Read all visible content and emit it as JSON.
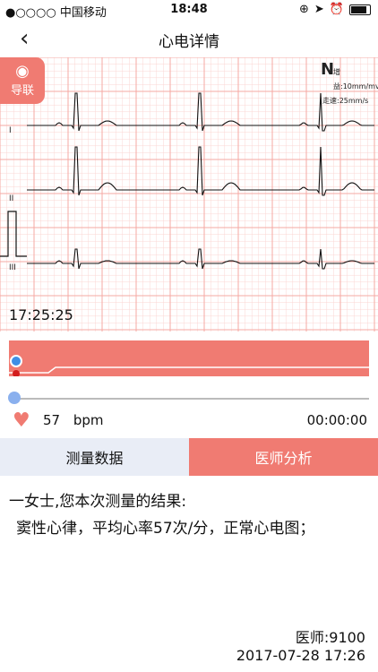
{
  "status": {
    "carrier": "●○○○○ 中国移动",
    "time": "18:48"
  },
  "nav": {
    "title": "心电详情"
  },
  "lead_button": {
    "label": "导联"
  },
  "ecg": {
    "scale_gain": "增益:10mm/mv",
    "scale_speed": "走速:25mm/s",
    "lead_labels": [
      "I",
      "II",
      "III"
    ],
    "timestamp": "17:25:25",
    "grid_color": "#f5a9a3",
    "trace_color": "#111111"
  },
  "heart_rate": {
    "value": "57",
    "unit": "bpm"
  },
  "duration": "00:00:00",
  "tabs": {
    "measure": "测量数据",
    "doctor_analysis": "医师分析"
  },
  "report": {
    "greeting": "一女士,您本次测量的结果:",
    "conclusion": "窦性心律，平均心率57次/分，正常心电图；",
    "doctor": "医师:9100",
    "time": "2017-07-28 17:26"
  },
  "colors": {
    "accent": "#f07b72",
    "tab_inactive": "#e9edf6"
  }
}
